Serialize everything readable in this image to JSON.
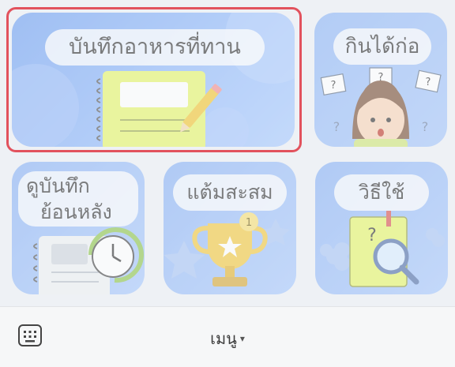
{
  "menu": {
    "tiles": [
      {
        "id": "record-meals",
        "label": "บันทึกอาหารที่ทาน"
      },
      {
        "id": "eat-first",
        "label": "กินได้ก่อ"
      },
      {
        "id": "view-history",
        "label_line1": "ดูบันทึก",
        "label_line2": "ย้อนหลัง"
      },
      {
        "id": "points",
        "label": "แต้มสะสม"
      },
      {
        "id": "how-to",
        "label": "วิธีใช้"
      }
    ],
    "trophy_badge": "1",
    "question_mark": "?"
  },
  "bottom_bar": {
    "menu_label": "เมนู",
    "caret": "▾"
  },
  "colors": {
    "highlight": "#e2525d",
    "tile_blue": "#7aaaf5",
    "notebook_yellow": "#e6f56a"
  }
}
